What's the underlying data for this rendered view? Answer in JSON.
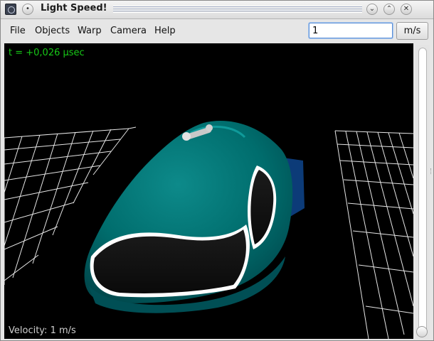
{
  "window": {
    "title": "Light Speed!",
    "app_icon": "lightspeed-app-icon",
    "buttons": {
      "menu_icon": "dot-menu-icon",
      "minimize_icon": "chevron-down-icon",
      "maximize_icon": "chevron-up-icon"
    }
  },
  "menu": {
    "items": [
      "File",
      "Objects",
      "Warp",
      "Camera",
      "Help"
    ]
  },
  "speed": {
    "value": "1",
    "unit_label": "m/s"
  },
  "viewport": {
    "time_readout": "t = +0,026 µsec",
    "velocity_readout": "Velocity: 1 m/s",
    "colors": {
      "background": "#000000",
      "grid": "#ffffff",
      "ship_body": "#006d6d",
      "ship_glass": "#111111",
      "time_text": "#17c817"
    }
  }
}
